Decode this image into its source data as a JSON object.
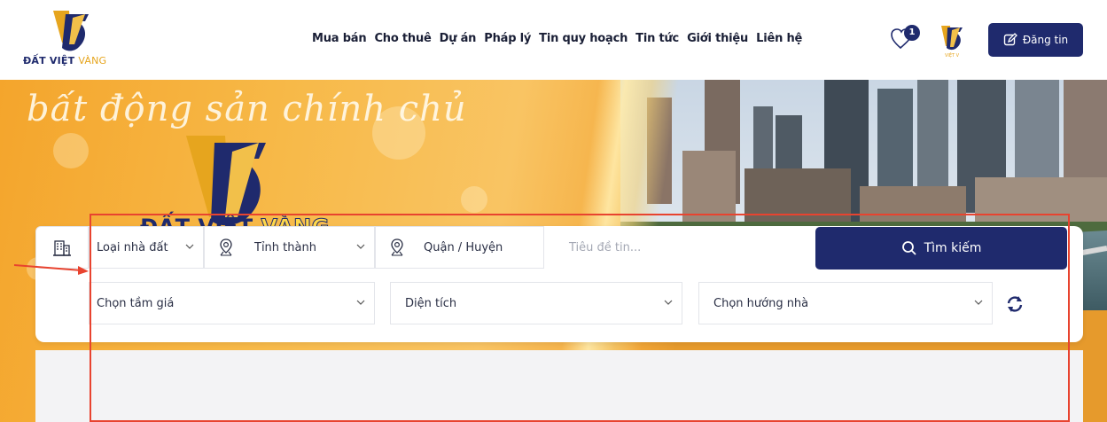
{
  "header": {
    "logo_text_dark": "ĐẤT VIỆT",
    "logo_text_gold": "VÀNG",
    "nav": [
      {
        "label": "Mua bán"
      },
      {
        "label": "Cho thuê"
      },
      {
        "label": "Dự án"
      },
      {
        "label": "Pháp lý"
      },
      {
        "label": "Tin quy hoạch"
      },
      {
        "label": "Tin tức"
      },
      {
        "label": "Giới thiệu"
      },
      {
        "label": "Liên hệ"
      }
    ],
    "favorites_count": "1",
    "post_button_label": "Đăng tin",
    "mini_logo_text": "VIỆT V"
  },
  "banner": {
    "tagline": "bất động sản chính chủ",
    "logo_text_dark": "ĐẤT VIỆT",
    "logo_text_gold": "VÀNG"
  },
  "search": {
    "property_type": "Loại nhà đất",
    "province": "Tỉnh thành",
    "district": "Quận / Huyện",
    "title_placeholder": "Tiêu đề tin...",
    "search_button": "Tìm kiếm",
    "price": "Chọn tầm giá",
    "area": "Diện tích",
    "direction": "Chọn hướng nhà"
  },
  "colors": {
    "brand_navy": "#1f2a6d",
    "brand_gold": "#e6a51e",
    "annotation_red": "#e8432f"
  }
}
